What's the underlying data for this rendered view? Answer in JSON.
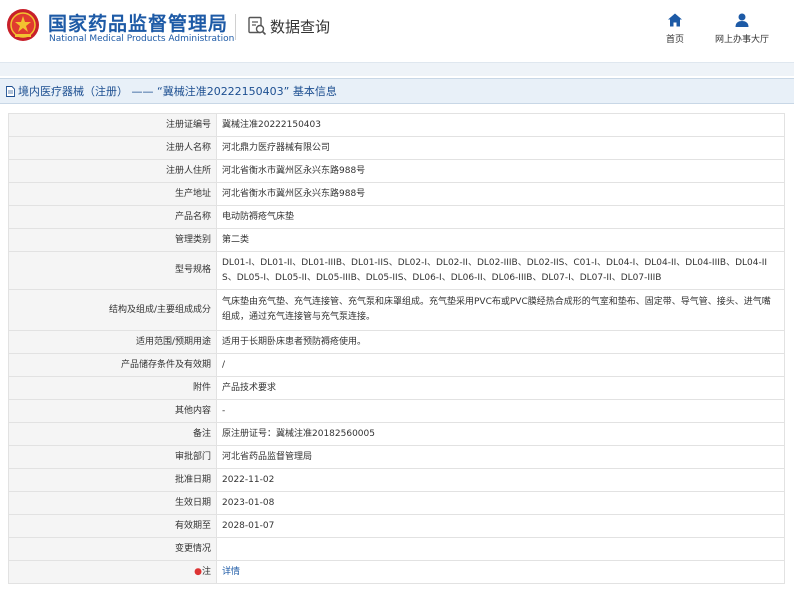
{
  "header": {
    "agency_cn": "国家药品监督管理局",
    "agency_en": "National Medical Products Administration",
    "query_title": "数据查询",
    "nav": {
      "home_label": "首页",
      "hall_label": "网上办事大厅"
    },
    "brand_color": "#1d5aa6"
  },
  "title_bar": {
    "text": "境内医疗器械（注册） —— “冀械注准20222150403” 基本信息"
  },
  "rows": [
    {
      "label": "注册证编号",
      "value": "冀械注准20222150403"
    },
    {
      "label": "注册人名称",
      "value": "河北鼎力医疗器械有限公司"
    },
    {
      "label": "注册人住所",
      "value": "河北省衡水市冀州区永兴东路988号"
    },
    {
      "label": "生产地址",
      "value": "河北省衡水市冀州区永兴东路988号"
    },
    {
      "label": "产品名称",
      "value": "电动防褥疮气床垫"
    },
    {
      "label": "管理类别",
      "value": "第二类"
    },
    {
      "label": "型号规格",
      "value": "DL01-I、DL01-II、DL01-IIIB、DL01-IIS、DL02-I、DL02-II、DL02-IIIB、DL02-IIS、C01-I、DL04-I、DL04-II、DL04-IIIB、DL04-IIS、DL05-I、DL05-II、DL05-IIIB、DL05-IIS、DL06-I、DL06-II、DL06-IIIB、DL07-I、DL07-II、DL07-IIIB"
    },
    {
      "label": "结构及组成/主要组成成分",
      "value": "气床垫由充气垫、充气连接管、充气泵和床罩组成。充气垫采用PVC布或PVC膜经热合成形的气室和垫布、固定带、导气管、接头、进气嘴组成，通过充气连接管与充气泵连接。"
    },
    {
      "label": "适用范围/预期用途",
      "value": "适用于长期卧床患者预防褥疮使用。"
    },
    {
      "label": "产品储存条件及有效期",
      "value": "/"
    },
    {
      "label": "附件",
      "value": "产品技术要求"
    },
    {
      "label": "其他内容",
      "value": "-"
    },
    {
      "label": "备注",
      "value": "原注册证号：冀械注准20182560005"
    },
    {
      "label": "审批部门",
      "value": "河北省药品监督管理局"
    },
    {
      "label": "批准日期",
      "value": "2022-11-02"
    },
    {
      "label": "生效日期",
      "value": "2023-01-08"
    },
    {
      "label": "有效期至",
      "value": "2028-01-07"
    },
    {
      "label": "变更情况",
      "value": ""
    },
    {
      "label": "注",
      "star": "●",
      "value": "详情"
    }
  ]
}
